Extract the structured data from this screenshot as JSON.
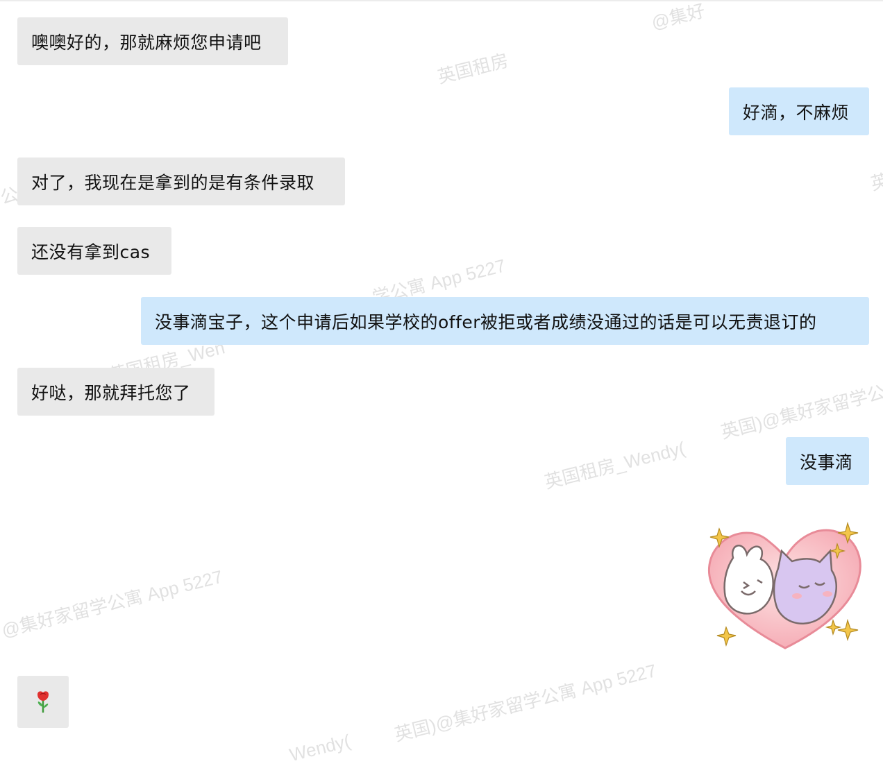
{
  "messages": [
    {
      "id": "m1",
      "side": "received",
      "text": "噢噢好的，那就麻烦您申请吧"
    },
    {
      "id": "m2",
      "side": "sent",
      "text": "好滴，不麻烦"
    },
    {
      "id": "m3",
      "side": "received",
      "text": "对了，我现在是拿到的是有条件录取"
    },
    {
      "id": "m4",
      "side": "received",
      "text": "还没有拿到cas"
    },
    {
      "id": "m5",
      "side": "sent",
      "text": "没事滴宝子，这个申请后如果学校的offer被拒或者成绩没通过的话是可以无责退订的"
    },
    {
      "id": "m6",
      "side": "received",
      "text": "好哒，那就拜托您了"
    },
    {
      "id": "m7",
      "side": "sent",
      "text": "没事滴"
    },
    {
      "id": "m8",
      "side": "sent",
      "type": "sticker",
      "icon": "heart-bunny-cat-sticker"
    },
    {
      "id": "m9",
      "side": "received",
      "type": "emoji",
      "icon": "rose-emoji"
    }
  ],
  "watermarks": [
    "@集好",
    "英国租房",
    "公寓",
    "英",
    "学公寓 App 5227",
    "英国租房_Wen",
    "英国)@集好家留学公寓",
    "英国租房_Wendy(",
    "@集好家留学公寓 App 5227",
    "英国)@集好家留学公寓 App 5227",
    "Wendy("
  ],
  "colors": {
    "received_bubble": "#e9e9e9",
    "sent_bubble": "#cfe8fc",
    "text": "#111111",
    "background": "#ffffff"
  }
}
